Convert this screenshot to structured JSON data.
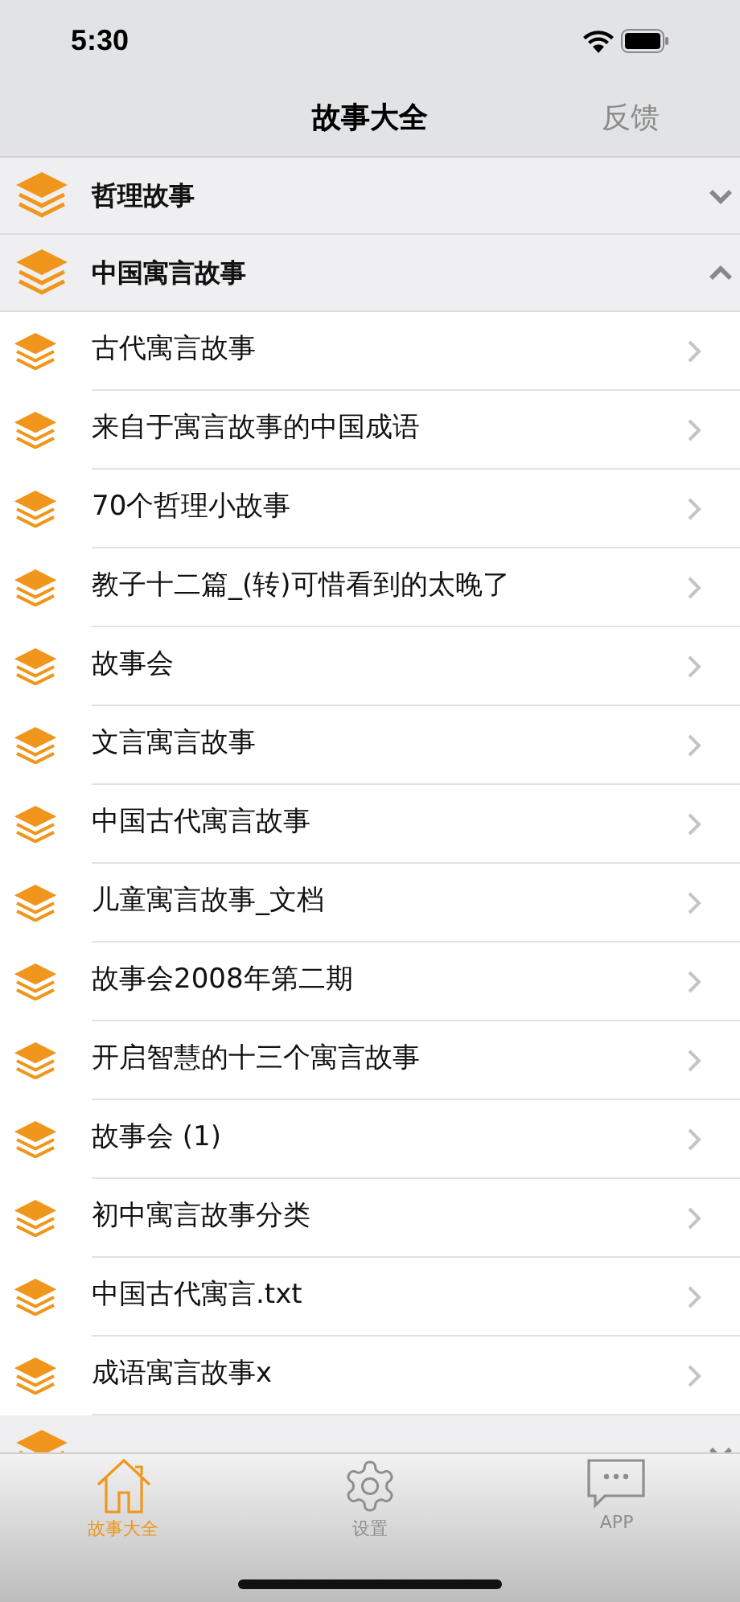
{
  "status_bar": {
    "time": "5:30"
  },
  "nav": {
    "title": "故事大全",
    "action": "反馈"
  },
  "sections": [
    {
      "title": "哲理故事",
      "expanded": false
    },
    {
      "title": "中国寓言故事",
      "expanded": true,
      "items": [
        "古代寓言故事",
        "来自于寓言故事的中国成语",
        "70个哲理小故事",
        "教子十二篇_(转)可惜看到的太晚了",
        "故事会",
        "文言寓言故事",
        "中国古代寓言故事",
        "儿童寓言故事_文档",
        "故事会2008年第二期",
        "开启智慧的十三个寓言故事",
        "故事会 (1)",
        "初中寓言故事分类",
        "中国古代寓言.txt",
        "成语寓言故事x"
      ]
    },
    {
      "expanded": false
    }
  ],
  "tabs": [
    {
      "kind": "home",
      "label": "故事大全",
      "selected": true
    },
    {
      "kind": "settings",
      "label": "设置",
      "selected": false
    },
    {
      "kind": "chat",
      "label": "APP",
      "selected": false
    }
  ]
}
